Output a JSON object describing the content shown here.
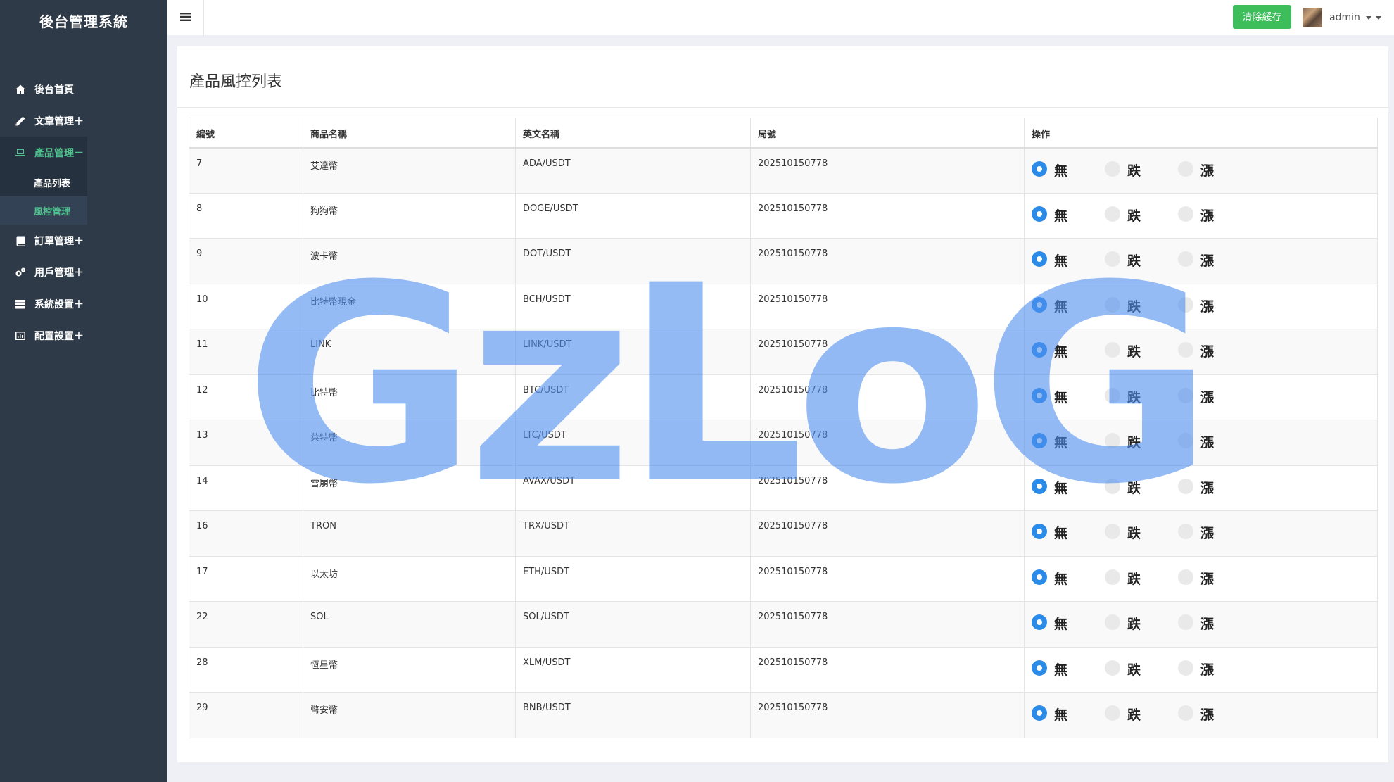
{
  "sidebar": {
    "brand": "後台管理系統",
    "items": [
      {
        "label": "後台首頁",
        "icon": "home-icon"
      },
      {
        "label": "文章管理＋",
        "icon": "pencil-icon"
      },
      {
        "label": "產品管理－",
        "icon": "laptop-icon"
      },
      {
        "label": "訂單管理＋",
        "icon": "book-icon"
      },
      {
        "label": "用戶管理＋",
        "icon": "gears-icon"
      },
      {
        "label": "系統設置＋",
        "icon": "server-icon"
      },
      {
        "label": "配置設置＋",
        "icon": "chart-icon"
      }
    ],
    "submenu": [
      {
        "label": "產品列表"
      },
      {
        "label": "風控管理"
      }
    ]
  },
  "topbar": {
    "clear_cache": "清除緩存",
    "user": "admin"
  },
  "panel": {
    "title": "產品風控列表"
  },
  "table": {
    "headers": [
      "編號",
      "商品名稱",
      "英文名稱",
      "局號",
      "操作"
    ],
    "options": [
      "無",
      "跌",
      "漲"
    ],
    "rows": [
      {
        "id": "7",
        "name": "艾達幣",
        "en": "ADA/USDT",
        "ju": "202510150778",
        "selected": "無"
      },
      {
        "id": "8",
        "name": "狗狗幣",
        "en": "DOGE/USDT",
        "ju": "202510150778",
        "selected": "無"
      },
      {
        "id": "9",
        "name": "波卡幣",
        "en": "DOT/USDT",
        "ju": "202510150778",
        "selected": "無"
      },
      {
        "id": "10",
        "name": "比特幣現金",
        "en": "BCH/USDT",
        "ju": "202510150778",
        "selected": "無"
      },
      {
        "id": "11",
        "name": "LINK",
        "en": "LINK/USDT",
        "ju": "202510150778",
        "selected": "無"
      },
      {
        "id": "12",
        "name": "比特幣",
        "en": "BTC/USDT",
        "ju": "202510150778",
        "selected": "無"
      },
      {
        "id": "13",
        "name": "萊特幣",
        "en": "LTC/USDT",
        "ju": "202510150778",
        "selected": "無"
      },
      {
        "id": "14",
        "name": "雪崩幣",
        "en": "AVAX/USDT",
        "ju": "202510150778",
        "selected": "無"
      },
      {
        "id": "16",
        "name": "TRON",
        "en": "TRX/USDT",
        "ju": "202510150778",
        "selected": "無"
      },
      {
        "id": "17",
        "name": "以太坊",
        "en": "ETH/USDT",
        "ju": "202510150778",
        "selected": "無"
      },
      {
        "id": "22",
        "name": "SOL",
        "en": "SOL/USDT",
        "ju": "202510150778",
        "selected": "無"
      },
      {
        "id": "28",
        "name": "恆星幣",
        "en": "XLM/USDT",
        "ju": "202510150778",
        "selected": "無"
      },
      {
        "id": "29",
        "name": "幣安幣",
        "en": "BNB/USDT",
        "ju": "202510150778",
        "selected": "無"
      }
    ]
  },
  "watermark": "GzLoG",
  "colors": {
    "sidebar_bg": "#2f3a48",
    "accent_green": "#4fc08d",
    "button_green": "#3ebd5b",
    "radio_blue": "#2a8be8",
    "watermark_blue": "#4f8ff0"
  }
}
